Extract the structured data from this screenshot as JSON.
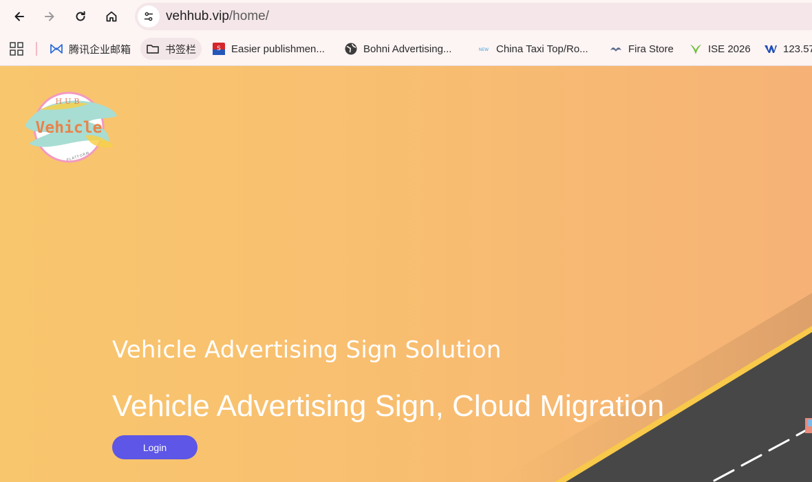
{
  "browser": {
    "url_host": "vehhub.vip",
    "url_path": "/home/"
  },
  "bookmarks": [
    {
      "label": "腾讯企业邮箱",
      "icon": "tencent-mail-icon"
    },
    {
      "label": "书签栏",
      "icon": "folder-icon"
    },
    {
      "label": "Easier publishmen...",
      "icon": "site-favicon"
    },
    {
      "label": "Bohni Advertising...",
      "icon": "globe-icon"
    },
    {
      "label": "China Taxi Top/Ro...",
      "icon": "site-favicon"
    },
    {
      "label": "Fira Store",
      "icon": "site-favicon"
    },
    {
      "label": "ISE 2026",
      "icon": "site-favicon"
    },
    {
      "label": "123.57",
      "icon": "site-favicon"
    }
  ],
  "logo": {
    "top_text": "HUB",
    "main_text": "Vehicle",
    "bottom_text": "PLATFORM"
  },
  "hero": {
    "subtitle": "Vehicle Advertising Sign Solution",
    "title": "Vehicle Advertising Sign, Cloud Migration",
    "login_label": "Login"
  },
  "colors": {
    "accent": "#5d56e6",
    "hero_start": "#f8c66d",
    "hero_end": "#f6b276",
    "road": "#474747",
    "road_edge": "#f8c94a"
  }
}
